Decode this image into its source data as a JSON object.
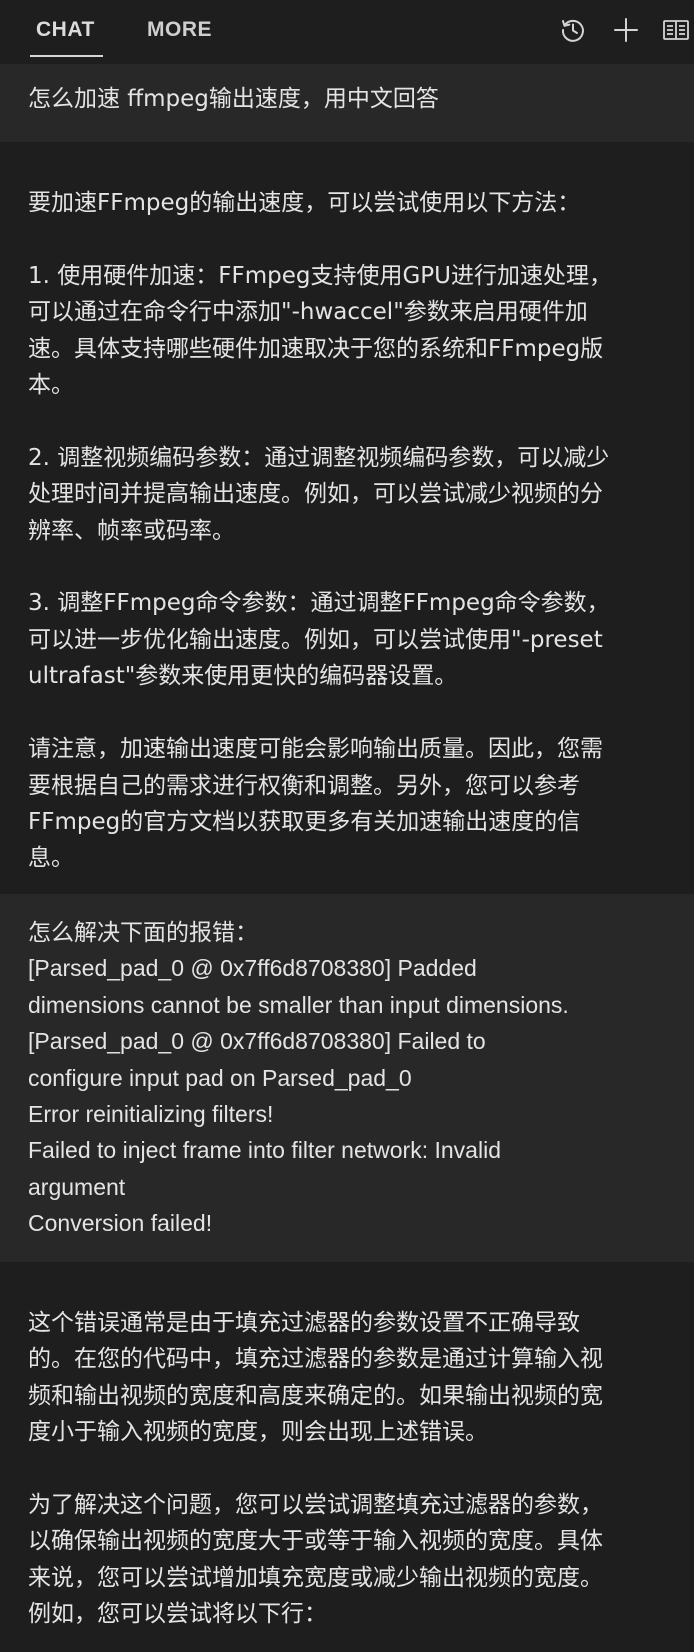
{
  "tabs": {
    "chat": "CHAT",
    "more": "MORE"
  },
  "icons": {
    "history": "history-icon",
    "new": "plus-icon",
    "book": "book-icon"
  },
  "colors": {
    "background": "#1e1e1e",
    "user_message_bg": "#282828",
    "text": "#e4e4e4"
  },
  "messages": [
    {
      "role": "user",
      "text": "怎么加速 ffmpeg输出速度，用中文回答"
    },
    {
      "role": "assistant",
      "text": "要加速FFmpeg的输出速度，可以尝试使用以下方法：\n\n1. 使用硬件加速：FFmpeg支持使用GPU进行加速处理，\n可以通过在命令行中添加\"-hwaccel\"参数来启用硬件加\n速。具体支持哪些硬件加速取决于您的系统和FFmpeg版\n本。\n\n2. 调整视频编码参数：通过调整视频编码参数，可以减少\n处理时间并提高输出速度。例如，可以尝试减少视频的分\n辨率、帧率或码率。\n\n3. 调整FFmpeg命令参数：通过调整FFmpeg命令参数，\n可以进一步优化输出速度。例如，可以尝试使用\"-preset\nultrafast\"参数来使用更快的编码器设置。\n\n请注意，加速输出速度可能会影响输出质量。因此，您需\n要根据自己的需求进行权衡和调整。另外，您可以参考\nFFmpeg的官方文档以获取更多有关加速输出速度的信\n息。"
    },
    {
      "role": "user",
      "text": "怎么解决下面的报错：\n[Parsed_pad_0 @ 0x7ff6d8708380] Padded\ndimensions cannot be smaller than input dimensions.\n[Parsed_pad_0 @ 0x7ff6d8708380] Failed to\nconfigure input pad on Parsed_pad_0\nError reinitializing filters!\nFailed to inject frame into filter network: Invalid\nargument\nConversion failed!"
    },
    {
      "role": "assistant",
      "text": "这个错误通常是由于填充过滤器的参数设置不正确导致\n的。在您的代码中，填充过滤器的参数是通过计算输入视\n频和输出视频的宽度和高度来确定的。如果输出视频的宽\n度小于输入视频的宽度，则会出现上述错误。\n\n为了解决这个问题，您可以尝试调整填充过滤器的参数，\n以确保输出视频的宽度大于或等于输入视频的宽度。具体\n来说，您可以尝试增加填充宽度或减少输出视频的宽度。\n例如，您可以尝试将以下行："
    }
  ]
}
